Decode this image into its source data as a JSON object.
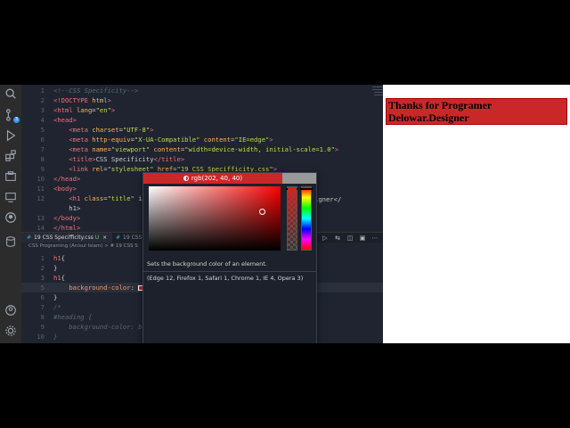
{
  "editor_top": {
    "lines": [
      {
        "n": "1",
        "parts": [
          [
            "c-comment",
            "<!--CSS Specificity-->"
          ]
        ]
      },
      {
        "n": "2",
        "parts": [
          [
            "c-tag",
            "<!DOCTYPE "
          ],
          [
            "c-attr",
            "html"
          ],
          [
            "c-tag",
            ">"
          ]
        ]
      },
      {
        "n": "3",
        "parts": [
          [
            "c-tag",
            "<html "
          ],
          [
            "c-attr",
            "lang"
          ],
          [
            "c-txt",
            "="
          ],
          [
            "c-str",
            "\"en\""
          ],
          [
            "c-tag",
            ">"
          ]
        ]
      },
      {
        "n": "4",
        "parts": [
          [
            "c-tag",
            "<head>"
          ]
        ]
      },
      {
        "n": "5",
        "parts": [
          [
            "c-txt",
            "    "
          ],
          [
            "c-tag",
            "<meta "
          ],
          [
            "c-attr",
            "charset"
          ],
          [
            "c-txt",
            "="
          ],
          [
            "c-str",
            "\"UTF-8\""
          ],
          [
            "c-tag",
            ">"
          ]
        ]
      },
      {
        "n": "6",
        "parts": [
          [
            "c-txt",
            "    "
          ],
          [
            "c-tag",
            "<meta "
          ],
          [
            "c-attr",
            "http-equiv"
          ],
          [
            "c-txt",
            "="
          ],
          [
            "c-str",
            "\"X-UA-Compatible\""
          ],
          [
            "c-attr",
            " content"
          ],
          [
            "c-txt",
            "="
          ],
          [
            "c-str",
            "\"IE=edge\""
          ],
          [
            "c-tag",
            ">"
          ]
        ]
      },
      {
        "n": "7",
        "parts": [
          [
            "c-txt",
            "    "
          ],
          [
            "c-tag",
            "<meta "
          ],
          [
            "c-attr",
            "name"
          ],
          [
            "c-txt",
            "="
          ],
          [
            "c-str",
            "\"viewport\""
          ],
          [
            "c-attr",
            " content"
          ],
          [
            "c-txt",
            "="
          ],
          [
            "c-str",
            "\"width=device-width, initial-scale=1.0\""
          ],
          [
            "c-tag",
            ">"
          ]
        ]
      },
      {
        "n": "8",
        "parts": [
          [
            "c-txt",
            "    "
          ],
          [
            "c-tag",
            "<title>"
          ],
          [
            "c-txt",
            "CSS Specificity"
          ],
          [
            "c-tag",
            "</title>"
          ]
        ]
      },
      {
        "n": "9",
        "parts": [
          [
            "c-txt",
            "    "
          ],
          [
            "c-tag",
            "<link "
          ],
          [
            "c-attr",
            "rel"
          ],
          [
            "c-txt",
            "="
          ],
          [
            "c-str",
            "\"stylesheet\""
          ],
          [
            "c-attr",
            " href"
          ],
          [
            "c-txt",
            "="
          ],
          [
            "c-str",
            "\"19 CSS Specifficity.css\""
          ],
          [
            "c-tag",
            ">"
          ]
        ]
      },
      {
        "n": "10",
        "parts": [
          [
            "c-tag",
            "</head>"
          ]
        ]
      },
      {
        "n": "11",
        "parts": [
          [
            "c-tag",
            "<body>"
          ]
        ]
      },
      {
        "n": "12",
        "parts": [
          [
            "c-txt",
            "    "
          ],
          [
            "c-tag",
            "<h1 "
          ],
          [
            "c-attr",
            "class"
          ],
          [
            "c-txt",
            "="
          ],
          [
            "c-str",
            "\"title\""
          ],
          [
            "c-txt",
            " i"
          ]
        ]
      },
      {
        "n": "",
        "parts": [
          [
            "c-txt",
            "    h1>"
          ]
        ]
      },
      {
        "n": "13",
        "parts": [
          [
            "c-tag",
            "</body>"
          ]
        ]
      },
      {
        "n": "14",
        "parts": [
          [
            "c-tag",
            "</html>"
          ]
        ]
      }
    ],
    "line12_tail": "igner</"
  },
  "tabs": {
    "tab1": "19 CSS Specifficity.css",
    "tab1_suffix": "U",
    "tab2": "19 CSS S"
  },
  "breadcrumb": "CSS Programing (Anisul Islam)  >  # 19 CSS S",
  "editor_bottom": {
    "lines": [
      {
        "n": "1",
        "parts": [
          [
            "c-tag",
            "h1"
          ],
          [
            "c-txt",
            "{"
          ]
        ]
      },
      {
        "n": "2",
        "parts": [
          [
            "c-txt",
            "}"
          ]
        ]
      },
      {
        "n": "3",
        "parts": [
          [
            "c-tag",
            "h1"
          ],
          [
            "c-txt",
            "{"
          ]
        ]
      },
      {
        "n": "5",
        "parts": [
          [
            "c-txt",
            "    "
          ],
          [
            "c-prop",
            "background-color"
          ],
          [
            "c-txt",
            ": "
          ],
          [
            "swatch",
            ""
          ],
          [
            "c-val",
            "rgb(202, 40, 40)"
          ],
          [
            "c-txt",
            ";"
          ]
        ]
      },
      {
        "n": "6",
        "parts": [
          [
            "c-txt",
            "}"
          ]
        ]
      },
      {
        "n": "7",
        "parts": [
          [
            "c-comment",
            "/*"
          ]
        ]
      },
      {
        "n": "8",
        "parts": [
          [
            "c-comment",
            "#heading {"
          ]
        ]
      },
      {
        "n": "9",
        "parts": [
          [
            "c-comment",
            "    background-color: blue;"
          ]
        ]
      },
      {
        "n": "10",
        "parts": [
          [
            "c-comment",
            "}"
          ]
        ]
      }
    ]
  },
  "color_picker": {
    "value_label": "rgb(202, 40, 40)",
    "color": "#ca2828",
    "description": "Sets the background color of an element.",
    "compat": "(Edge 12, Firefox 1, Safari 1, Chrome 1, IE 4, Opera 3)"
  },
  "preview": {
    "heading": "Thanks for Programer Delowar.Designer",
    "bg_color": "#ca2828"
  },
  "activity_icons": [
    "search-icon",
    "source-control-icon",
    "run-debug-icon",
    "extensions-icon",
    "explorer-icon",
    "remote-icon",
    "github-icon",
    "database-icon",
    "account-icon",
    "settings-icon"
  ],
  "source_control_badge": "3"
}
